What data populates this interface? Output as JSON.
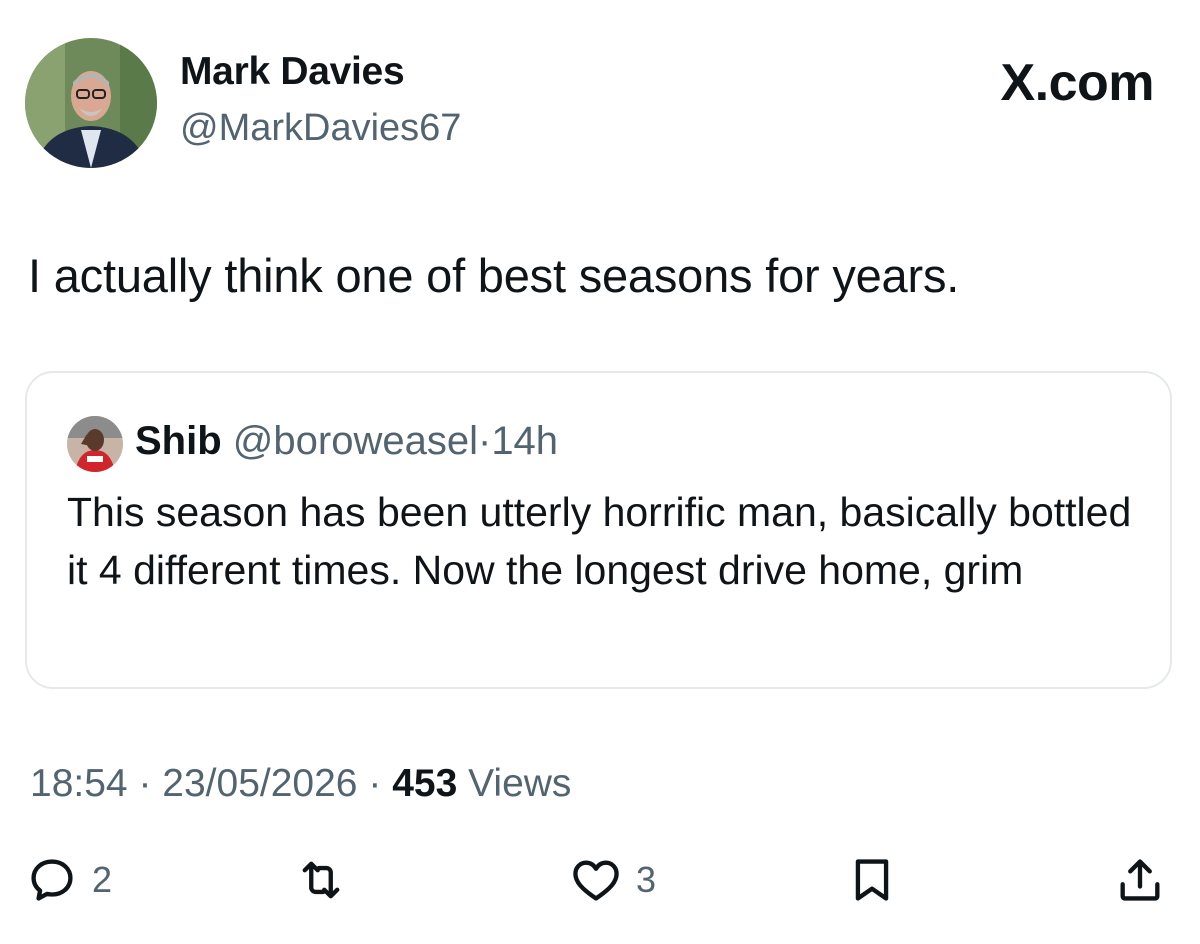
{
  "author": {
    "name": "Mark Davies",
    "handle": "@MarkDavies67"
  },
  "brand": "X.com",
  "tweet": {
    "text": "I actually think one of best seasons for years."
  },
  "quoted": {
    "name": "Shib",
    "handle": "@boroweasel",
    "separator": "·",
    "time": "14h",
    "text": "This season has been utterly horrific man, basically bottled it 4 different times. Now the longest drive home, grim"
  },
  "meta": {
    "time": "18:54",
    "date": "23/05/2026",
    "separator": "·",
    "views_count": "453",
    "views_label": "Views"
  },
  "actions": {
    "reply_icon": "reply-icon",
    "reply_count": "2",
    "retweet_icon": "retweet-icon",
    "like_icon": "heart-icon",
    "like_count": "3",
    "bookmark_icon": "bookmark-icon",
    "share_icon": "share-icon"
  },
  "colors": {
    "text": "#0f1419",
    "secondary": "#536471",
    "border": "#e6e9ec"
  }
}
